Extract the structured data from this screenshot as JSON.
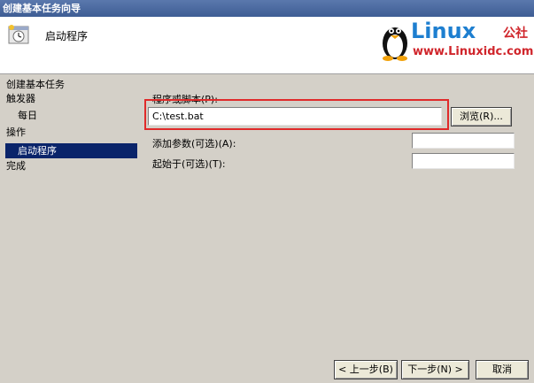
{
  "window": {
    "title": "创建基本任务向导"
  },
  "header": {
    "title": "启动程序"
  },
  "watermark": {
    "brand": "Linux",
    "brand_cn": "公社",
    "url": "www.Linuxidc.com"
  },
  "nav": {
    "title": "创建基本任务",
    "items": [
      {
        "label": "触发器"
      },
      {
        "label": "每日"
      },
      {
        "label": "操作"
      },
      {
        "label": "启动程序",
        "selected": true
      },
      {
        "label": "完成"
      }
    ]
  },
  "form": {
    "program_label": "程序或脚本(P):",
    "program_value": "C:\\test.bat",
    "browse_label": "浏览(R)...",
    "args_label": "添加参数(可选)(A):",
    "args_value": "",
    "start_in_label": "起始于(可选)(T):",
    "start_in_value": ""
  },
  "footer": {
    "back_label": "< 上一步(B)",
    "next_label": "下一步(N) >",
    "cancel_label": "取消"
  },
  "colors": {
    "selection": "#0a246a",
    "highlight_box": "#e02a2a",
    "titlebar": "#3e5d94"
  }
}
